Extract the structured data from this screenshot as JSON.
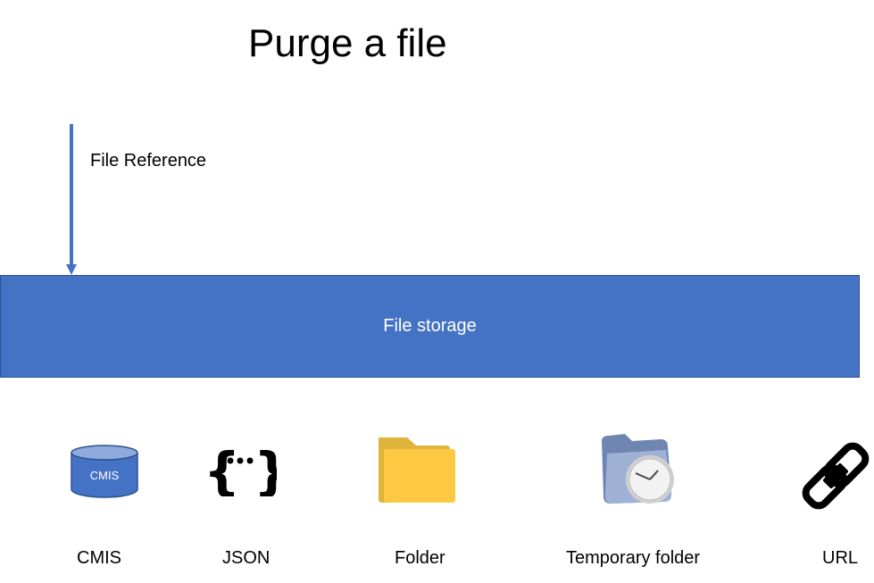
{
  "title": "Purge a file",
  "input": {
    "label": "File Reference"
  },
  "storage": {
    "label": "File storage",
    "color": "#4472c4"
  },
  "storage_types": [
    {
      "label": "CMIS",
      "icon": "database-cylinder-icon",
      "icon_text": "CMIS"
    },
    {
      "label": "JSON",
      "icon": "json-braces-icon"
    },
    {
      "label": "Folder",
      "icon": "folder-icon"
    },
    {
      "label": "Temporary folder",
      "icon": "folder-clock-icon"
    },
    {
      "label": "URL",
      "icon": "link-icon"
    }
  ]
}
